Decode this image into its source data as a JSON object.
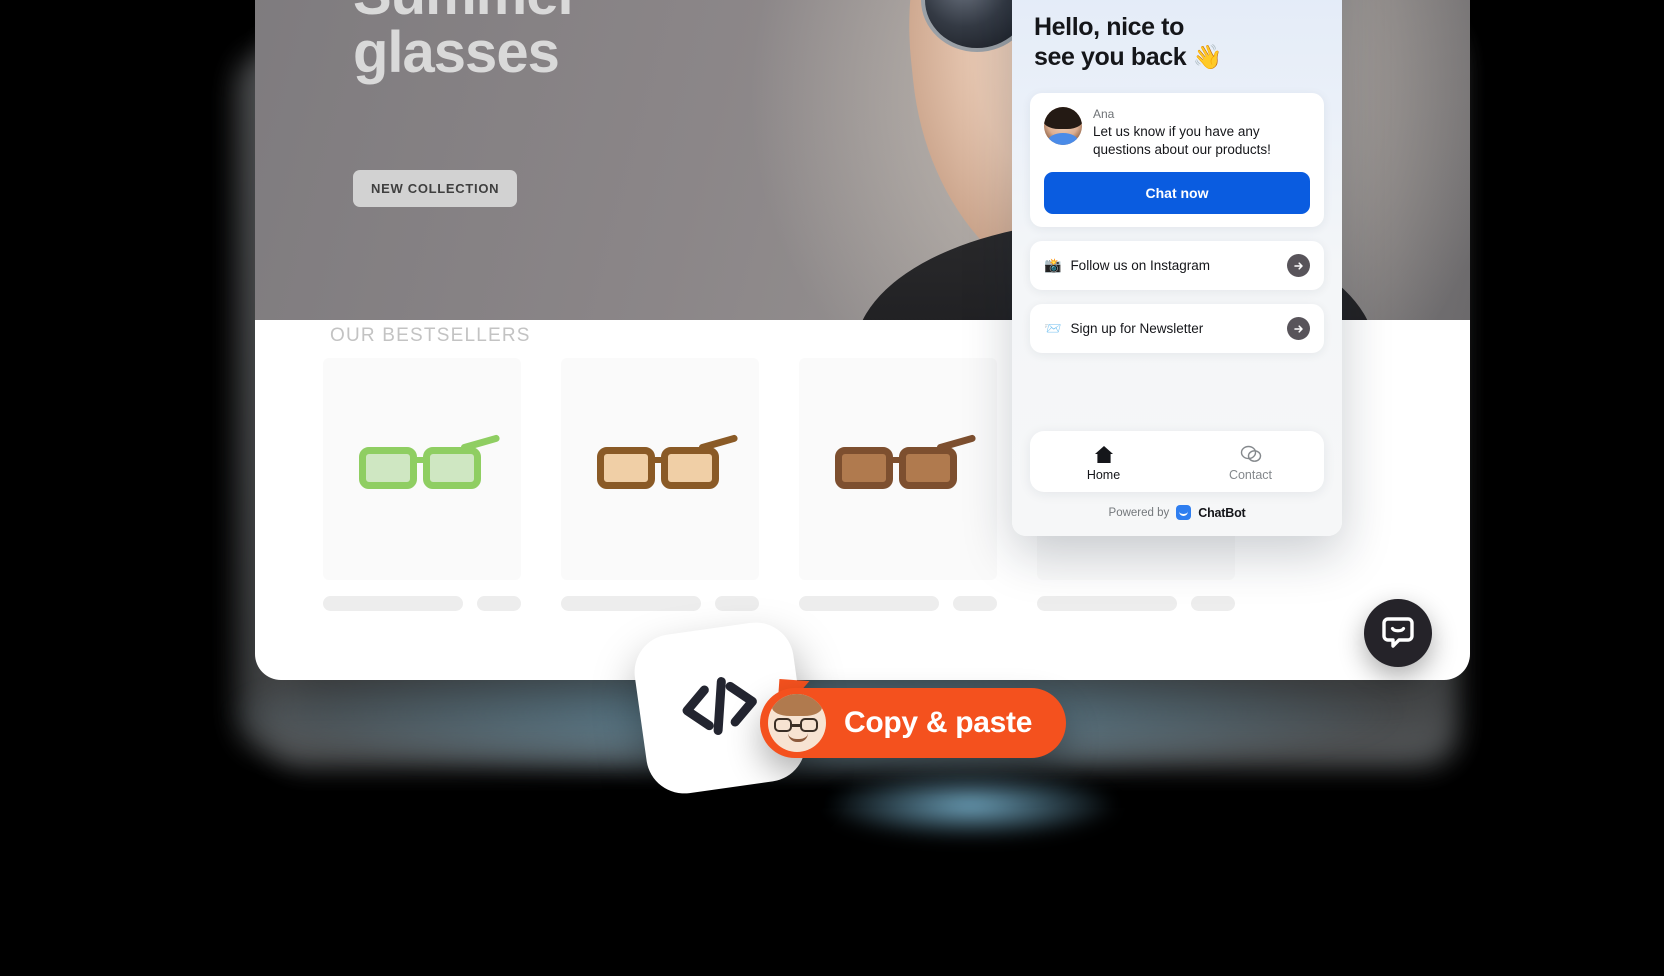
{
  "website": {
    "hero": {
      "title_line1": "Summer",
      "title_line2": "glasses",
      "cta_label": "NEW COLLECTION"
    },
    "bestsellers": {
      "section_title": "OUR BESTSELLERS",
      "products": [
        {
          "name": "green-sunglasses"
        },
        {
          "name": "tortoiseshell-sunglasses"
        },
        {
          "name": "brown-sunglasses"
        }
      ]
    }
  },
  "widget": {
    "greeting_line1": "Hello, nice to",
    "greeting_line2": "see you back",
    "wave_emoji": "👋",
    "message_card": {
      "agent_name": "Ana",
      "message": "Let us know if you have any questions about our products!",
      "button_label": "Chat now"
    },
    "quick_links": [
      {
        "emoji": "📸",
        "label": "Follow us on Instagram",
        "icon": "arrow-right-icon"
      },
      {
        "emoji": "📨",
        "label": "Sign up for Newsletter",
        "icon": "arrow-right-icon"
      }
    ],
    "nav": [
      {
        "label": "Home",
        "icon": "home-icon",
        "active": true
      },
      {
        "label": "Contact",
        "icon": "chat-bubbles-icon",
        "active": false
      }
    ],
    "footer": {
      "powered_by": "Powered by",
      "brand": "ChatBot"
    }
  },
  "overlays": {
    "code_card": {
      "icon": "code-icon"
    },
    "badge": {
      "label": "Copy & paste",
      "avatar": "person-avatar"
    },
    "chat_toggle": {
      "icon": "chatbot-logo-icon"
    }
  },
  "colors": {
    "accent_blue": "#0A5CE0",
    "accent_orange": "#F4511E",
    "toggle_dark": "#252329",
    "brand_blue": "#2F7EF0"
  }
}
